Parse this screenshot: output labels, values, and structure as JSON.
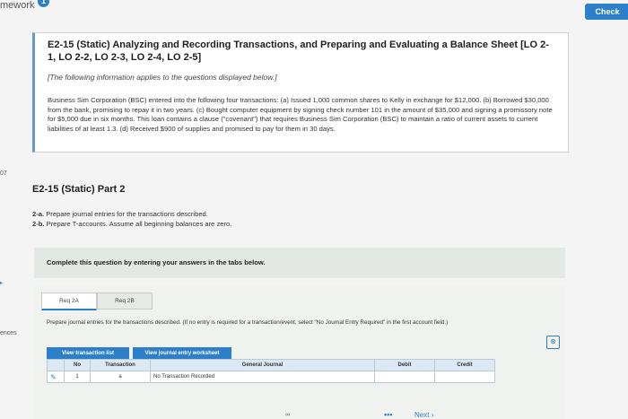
{
  "topbar": {
    "title": "mework",
    "badge": "1",
    "check_label": "Check"
  },
  "left_edge": {
    "number": "07",
    "label": "ences"
  },
  "problem": {
    "title": "E2-15 (Static) Analyzing and Recording Transactions, and Preparing and Evaluating a Balance Sheet [LO 2-1, LO 2-2, LO 2-3, LO 2-4, LO 2-5]",
    "note": "[The following information applies to the questions displayed below.]",
    "body": "Business Sim Corporation (BSC) entered into the following four transactions: (a) Issued 1,000 common shares to Kelly in exchange for $12,000. (b) Borrowed $30,000 from the bank, promising to repay it in two years. (c) Bought computer equipment by signing check number 101 in the amount of $35,000 and signing a promissory note for $5,000 due in six months. This loan contains a clause (\"covenant\") that requires Business Sim Corporation (BSC) to maintain a ratio of current assets to current liabilities of at least 1.3. (d) Received $900 of supplies and promised to pay for them in 30 days."
  },
  "part": {
    "title": "E2-15 (Static) Part 2",
    "line_a_label": "2-a.",
    "line_a": "Prepare journal entries for the transactions described.",
    "line_b_label": "2-b.",
    "line_b": "Prepare T-accounts. Assume all beginning balances are zero."
  },
  "complete": {
    "text": "Complete this question by entering your answers in the tabs below."
  },
  "tabs": [
    {
      "label": "Req 2A"
    },
    {
      "label": "Req 2B"
    }
  ],
  "instruction": "Prepare journal entries for the transactions described. (If no entry is required for a transaction/event, select \"No Journal Entry Required\" in the first account field.)",
  "buttons": {
    "view_transaction_list": "View transaction list",
    "view_journal_worksheet": "View journal entry worksheet"
  },
  "table": {
    "headers": {
      "no": "No",
      "transaction": "Transaction",
      "general_journal": "General Journal",
      "debit": "Debit",
      "credit": "Credit"
    },
    "rows": [
      {
        "no": "1",
        "transaction": "a",
        "general_journal": "No Transaction Recorded",
        "debit": "",
        "credit": ""
      }
    ]
  },
  "footer": {
    "next_label": "Next"
  },
  "colors": {
    "accent": "#2d7fc9"
  }
}
